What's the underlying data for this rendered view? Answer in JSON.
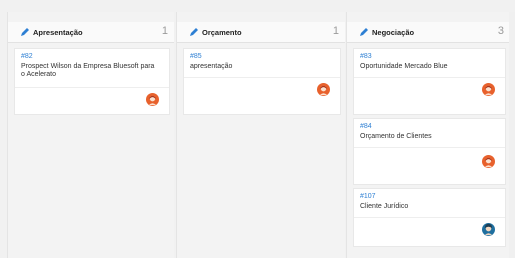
{
  "columns": [
    {
      "title": "Apresentação",
      "count": "1",
      "cards": [
        {
          "id": "#82",
          "description": "Prospect Wilson da Empresa Bluesoft para o Acelerato",
          "avatar": "female-avatar"
        }
      ]
    },
    {
      "title": "Orçamento",
      "count": "1",
      "cards": [
        {
          "id": "#85",
          "description": "apresentação",
          "avatar": "female-avatar"
        }
      ]
    },
    {
      "title": "Negociação",
      "count": "3",
      "cards": [
        {
          "id": "#83",
          "description": "Oportunidade Mercado Blue",
          "avatar": "female-avatar"
        },
        {
          "id": "#84",
          "description": "Orçamento de Clientes",
          "avatar": "female-avatar"
        },
        {
          "id": "#107",
          "description": "Cliente Jurídico",
          "avatar": "male-avatar"
        }
      ]
    }
  ],
  "colors": {
    "accent": "#2d7fd3",
    "female_avatar_bg": "#e8612c",
    "male_avatar_bg": "#1f6f9f"
  }
}
